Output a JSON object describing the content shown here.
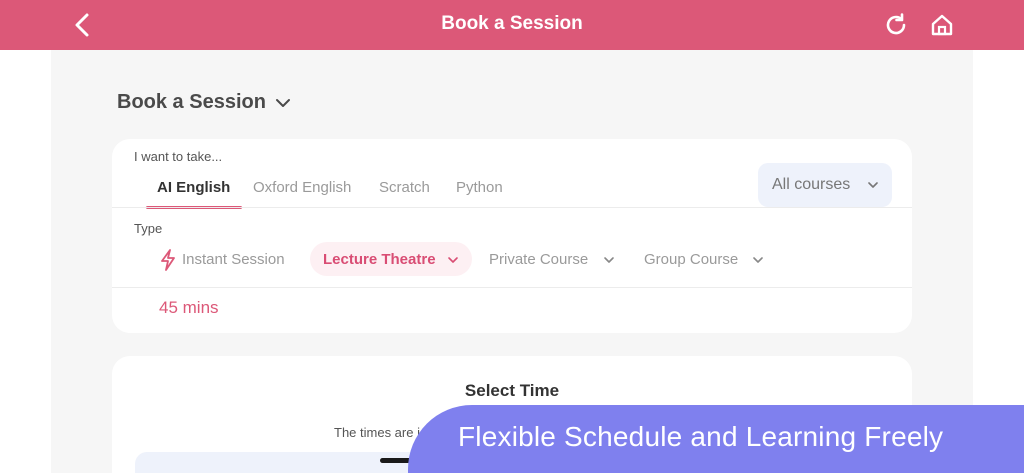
{
  "header": {
    "title": "Book a Session",
    "back_icon": "chevron-left-icon",
    "refresh_icon": "refresh-icon",
    "home_icon": "home-icon",
    "color": "#dc5878"
  },
  "page": {
    "title": "Book a Session"
  },
  "course": {
    "label": "I want to take...",
    "tabs": [
      "AI English",
      "Oxford English",
      "Scratch",
      "Python"
    ],
    "active_tab": "AI English",
    "filter": "All courses"
  },
  "type": {
    "label": "Type",
    "options": [
      "Instant Session",
      "Lecture Theatre",
      "Private Course",
      "Group Course"
    ],
    "selected": "Lecture Theatre"
  },
  "duration": "45 mins",
  "select_time": {
    "title": "Select Time",
    "note": "The times are i"
  },
  "banner": {
    "text": "Flexible Schedule and Learning Freely",
    "color": "#7f80ee"
  }
}
